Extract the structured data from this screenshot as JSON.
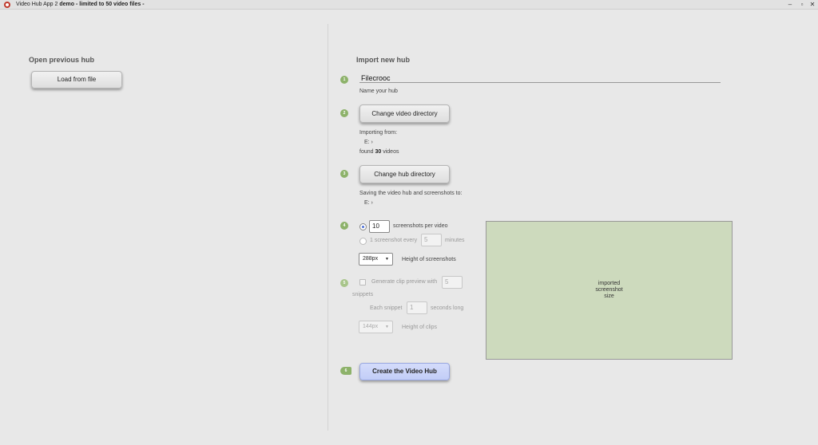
{
  "window": {
    "title_prefix": "Video Hub App 2",
    "title_bold": "demo - limited to 50 video files -",
    "min": "–",
    "max": "▫",
    "close": "✕"
  },
  "left": {
    "heading": "Open previous hub",
    "load_button": "Load from file"
  },
  "right": {
    "heading": "Import new hub",
    "steps": [
      "1",
      "2",
      "3",
      "4",
      "5",
      "6"
    ],
    "hub_name": "Filecrooc",
    "hub_name_hint": "Name your hub",
    "change_video_dir": "Change video directory",
    "importing_from_label": "Importing from:",
    "importing_from_path": "E: ›",
    "found_prefix": "found",
    "found_count": "30",
    "found_suffix": "videos",
    "change_hub_dir": "Change hub directory",
    "saving_label": "Saving the video hub and screenshots to:",
    "saving_path": "E: ›",
    "screenshots_per_video_value": "10",
    "screenshots_per_video_label": "screenshots per video",
    "one_screenshot_every_label": "1 screenshot every",
    "one_screenshot_every_value": "5",
    "minutes_label": "minutes",
    "height_select_value": "288px",
    "height_label": "Height of screenshots",
    "generate_clip_label": "Generate clip preview with",
    "snippets_value": "5",
    "snippets_label": "snippets",
    "each_snippet_label": "Each snippet",
    "snippet_seconds_value": "1",
    "seconds_long_label": "seconds long",
    "clip_height_value": "144px",
    "clip_height_label": "Height of clips",
    "preview_text": "imported\nscreenshot\nsize",
    "create_button": "Create the Video Hub"
  },
  "colors": {
    "step_green": "#8db26a",
    "preview_green": "#cddabd",
    "primary_button": "#c7d1f8"
  },
  "icons": {
    "app": "video-hub-app-icon",
    "select_caret": "chevron-down-icon"
  }
}
